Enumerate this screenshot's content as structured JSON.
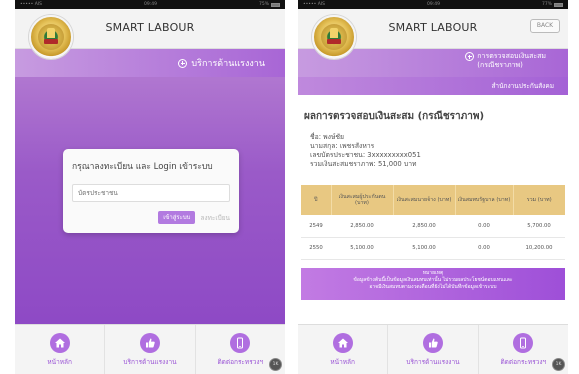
{
  "statusbar": {
    "left": {
      "carrier": "••••• AIS",
      "time": "09:49",
      "battery": "75%"
    },
    "right": {
      "carrier": "••••• AIS",
      "time": "09:49",
      "battery": "77%"
    }
  },
  "app": {
    "title": "SMART LABOUR"
  },
  "left": {
    "section_label": "บริการด้านแรงงาน",
    "login": {
      "title": "กรุณาลงทะเบียน และ Login เข้าระบบ",
      "id_placeholder": "บัตรประชาชน",
      "login_button": "เข้าสู่ระบบ",
      "register_link": "ลงทะเบียน"
    }
  },
  "right": {
    "back_button": "BACK",
    "section_label_line1": "การตรวจสอบเงินสะสม",
    "section_label_line2": "(กรณีชราภาพ)",
    "sub_label": "สำนักงานประกันสังคม",
    "result_title": "ผลการตรวจสอบเงินสะสม (กรณีชราภาพ)",
    "info": {
      "name": "ชื่อ: พงษ์ชัย",
      "surname": "นามสกุล: เพชรสังหาร",
      "id": "เลขบัตรประชาชน: 3xxxxxxxxx051",
      "total": "รวมเงินสะสมชราภาพ: 51,000 บาท"
    },
    "table": {
      "headers": [
        "ปี",
        "เงินสะสมผู้ประกันตน (บาท)",
        "เงินสะสมนายจ้าง (บาท)",
        "เงินสมทบรัฐบาล (บาท)",
        "รวม (บาท)"
      ],
      "rows": [
        [
          "2549",
          "2,850.00",
          "2,850.00",
          "0.00",
          "5,700.00"
        ],
        [
          "2550",
          "5,100.00",
          "5,100.00",
          "0.00",
          "10,200.00"
        ]
      ]
    },
    "note": {
      "title": "หมายเหตุ",
      "line1": "ข้อมูลข้างต้นนี้เป็นข้อมูลเงินสมทบเท่านั้น ไม่รวมผลประโยชน์ตอบแทนและ",
      "line2": "อาจมีเงินสมทบตามงวดเดือนที่ยังไม่ได้บันทึกข้อมูลเข้าระบบ"
    }
  },
  "nav": {
    "home": "หน้าหลัก",
    "services": "บริการด้านแรงงาน",
    "contact": "ติดต่อกระทรวงฯ"
  },
  "badge": "1K",
  "colors": {
    "accent": "#a866d6",
    "table_header": "#e8c882"
  },
  "icons": [
    "home-icon",
    "thumbs-up-icon",
    "phone-icon",
    "plus-circle-icon"
  ]
}
